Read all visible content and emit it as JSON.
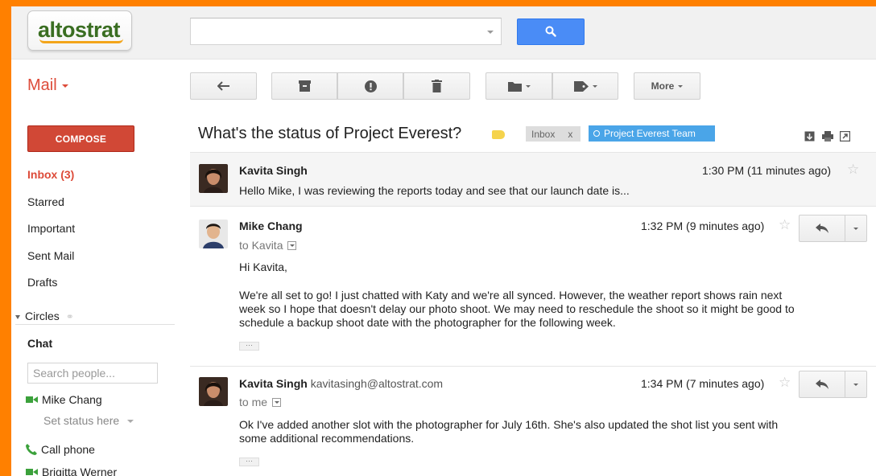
{
  "brand": {
    "logo_text": "altostrat"
  },
  "search": {
    "value": "",
    "placeholder": ""
  },
  "header": {
    "app_label": "Mail"
  },
  "toolbar": {
    "more_label": "More"
  },
  "sidebar": {
    "compose_label": "COMPOSE",
    "items": [
      {
        "label": "Inbox (3)",
        "active": true
      },
      {
        "label": "Starred"
      },
      {
        "label": "Important"
      },
      {
        "label": "Sent Mail"
      },
      {
        "label": "Drafts"
      }
    ],
    "circles_label": "Circles"
  },
  "chat": {
    "title": "Chat",
    "search_placeholder": "Search people...",
    "contacts": [
      {
        "name": "Mike Chang",
        "icon": "video-icon"
      },
      {
        "name": "Call phone",
        "icon": "phone-icon"
      },
      {
        "name": "Brigitta Werner",
        "icon": "video-icon"
      }
    ],
    "status_text": "Set status here"
  },
  "thread": {
    "subject": "What's the status of Project Everest?",
    "labels": [
      {
        "name": "Inbox",
        "remove": "x",
        "color": "#dddddd"
      },
      {
        "name": "Project Everest Team",
        "color": "#4aa5e8"
      }
    ]
  },
  "messages": [
    {
      "sender": "Kavita Singh",
      "time": "1:30 PM (11 minutes ago)",
      "snippet": "Hello Mike, I was reviewing the reports today and see that our launch date is..."
    },
    {
      "sender": "Mike Chang",
      "to": "to Kavita",
      "time": "1:32 PM (9 minutes ago)",
      "greeting": "Hi Kavita,",
      "body": [
        "We're all set to go! I just chatted with Katy and we're all synced. However, the weather report shows rain next",
        "week so I hope that doesn't delay our photo shoot. We may need to reschedule the shoot so it might be good to",
        "schedule a backup shoot date with the photographer for the following week."
      ],
      "ellipsis": "···"
    },
    {
      "sender": "Kavita Singh",
      "sender_email": "kavitasingh@altostrat.com",
      "to": "to me",
      "time": "1:34 PM (7 minutes ago)",
      "body": [
        "Ok I've added another slot with the photographer for July 16th. She's also updated the shot list you sent with",
        "some additional recommendations."
      ],
      "ellipsis": "···"
    }
  ],
  "colors": {
    "frame": "#ff8000",
    "accent_red": "#dd4b39",
    "compose": "#d14836",
    "search_blue": "#4a8cf6",
    "label_blue": "#4aa5e8",
    "important_yellow": "#f5d34c"
  }
}
